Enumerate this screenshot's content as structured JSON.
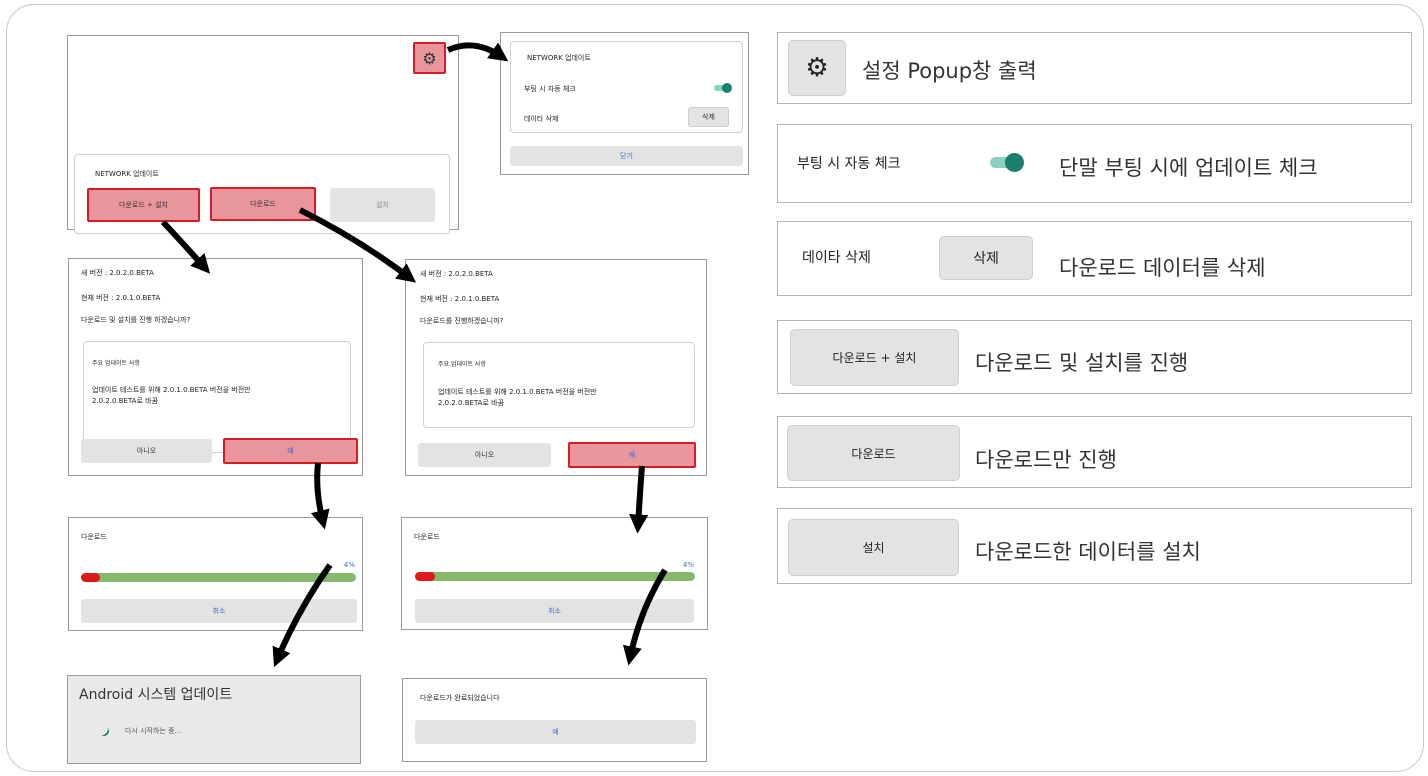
{
  "settings_popup": {
    "title": "NETWORK 업데이트",
    "auto_check_label": "부팅 시 자동 체크",
    "delete_label": "데이타 삭제",
    "delete_button": "삭제",
    "close_button": "닫기",
    "auto_check_on": true
  },
  "main_screen": {
    "panel_title": "NETWORK 업데이트",
    "download_install_button": "다운로드 + 설치",
    "download_button": "다운로드",
    "install_button": "설치"
  },
  "confirm_left": {
    "new_version": "새 버전 : 2.0.2.0.BETA",
    "current_version": "현재 버전 : 2.0.1.0.BETA",
    "question": "다운로드 및 설치를 진행 하겠습니까?",
    "notes_title": "주요 업데이트 사항",
    "notes_line1": "업데이트 테스트를 위해 2.0.1.0.BETA 버전을 버전만",
    "notes_line2": "2.0.2.0.BETA로 바꿈",
    "no_button": "아니오",
    "yes_button": "예"
  },
  "confirm_right": {
    "new_version": "새 버전 : 2.0.2.0.BETA",
    "current_version": "현재 버전 : 2.0.1.0.BETA",
    "question": "다운로드를 진행하겠습니까?",
    "notes_title": "주요 업데이트 사항",
    "notes_line1": "업데이트 테스트를 위해 2.0.1.0.BETA 버전을 버전만",
    "notes_line2": "2.0.2.0.BETA로 바꿈",
    "no_button": "아니오",
    "yes_button": "예"
  },
  "progress_left": {
    "title": "다운로드",
    "percent_text": "4%",
    "progress": 0.04,
    "cancel_button": "취소"
  },
  "progress_right": {
    "title": "다운로드",
    "percent_text": "4%",
    "progress": 0.04,
    "cancel_button": "취소"
  },
  "android_update": {
    "title": "Android 시스템 업데이트",
    "status": "다시 시작하는 중..."
  },
  "complete_dialog": {
    "message": "다운로드가 완료되었습니다",
    "ok_button": "예"
  },
  "legend": {
    "settings": {
      "text": "설정 Popup창 출력",
      "icon": "gear-icon"
    },
    "auto_check": {
      "label": "부팅 시 자동 체크",
      "text": "단말 부팅 시에 업데이트 체크"
    },
    "delete": {
      "label": "데이타 삭제",
      "button": "삭제",
      "text": "다운로드 데이터를 삭제"
    },
    "download_install": {
      "button": "다운로드 + 설치",
      "text": "다운로드 및 설치를 진행"
    },
    "download": {
      "button": "다운로드",
      "text": "다운로드만 진행"
    },
    "install": {
      "button": "설치",
      "text": "다운로드한 데이터를 설치"
    }
  },
  "colors": {
    "highlight_red": "#d41c22",
    "highlight_fill": "#e8959b",
    "toggle_teal": "#1a7f6e",
    "progress_green": "#84b86a",
    "progress_red": "#e01818",
    "link_blue": "#3a6fd0"
  }
}
